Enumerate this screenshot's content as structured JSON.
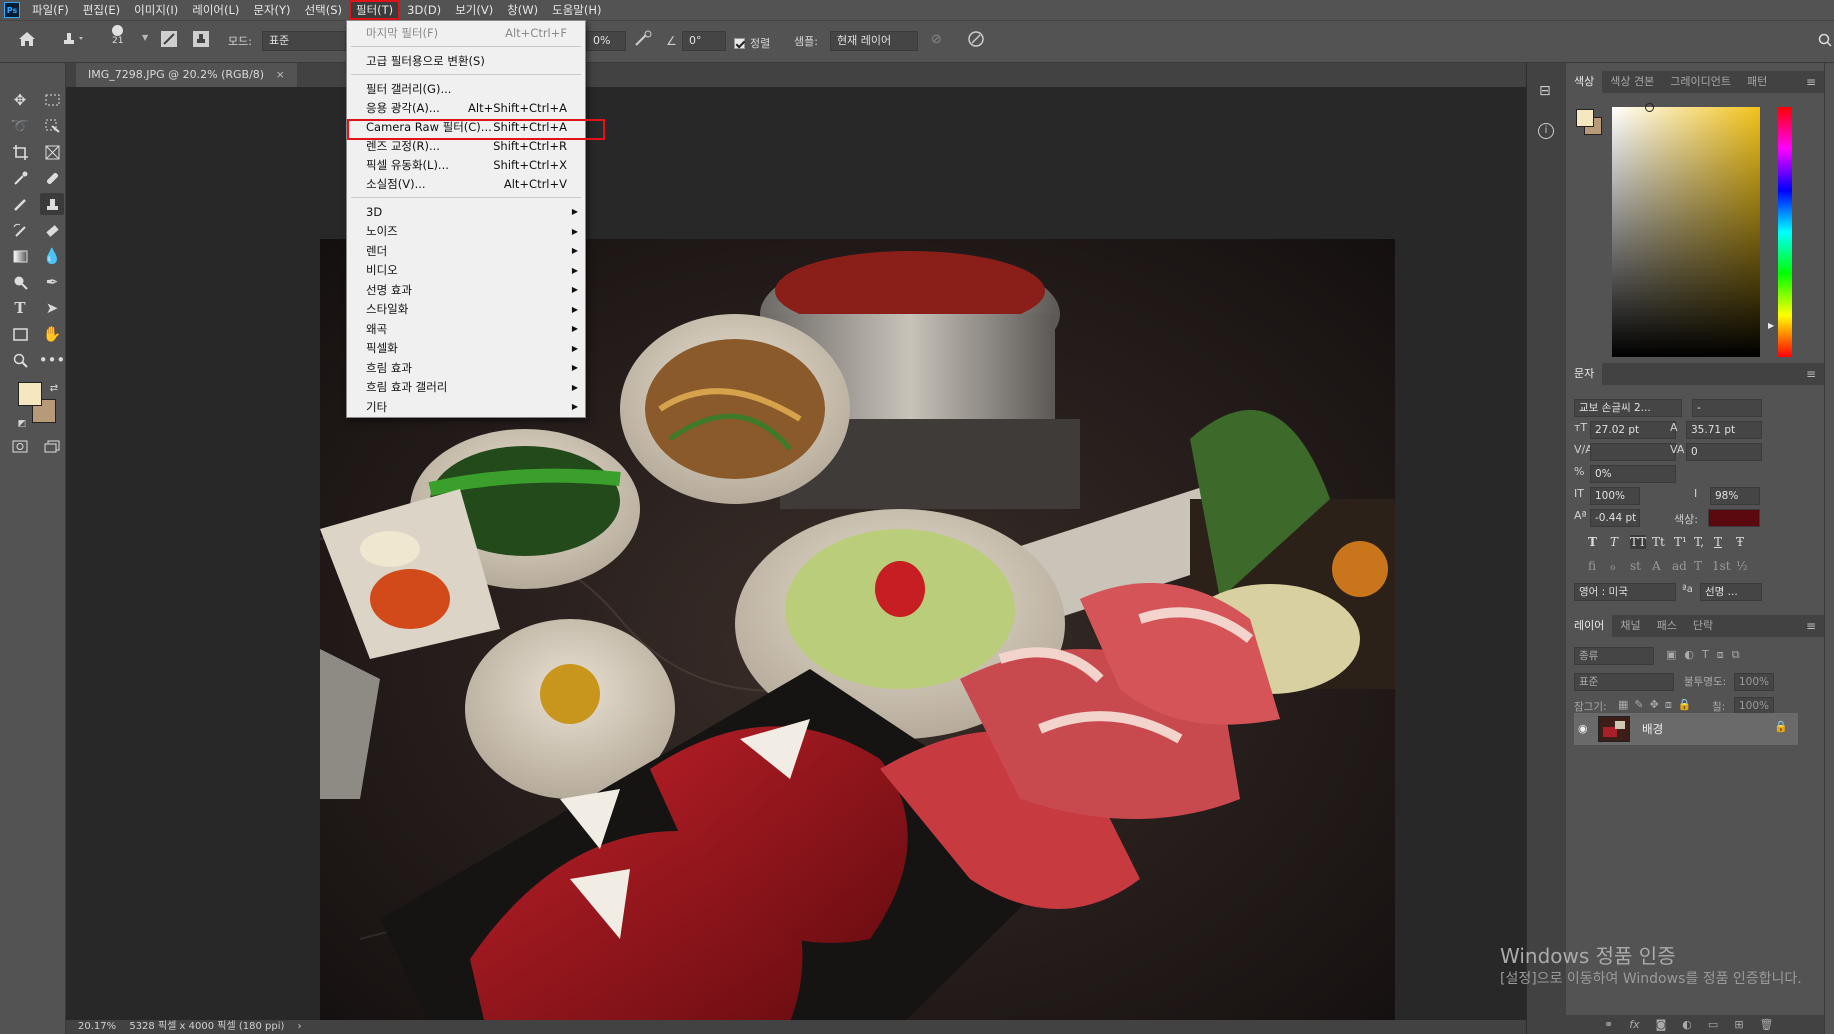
{
  "menubar": {
    "logo": "Ps",
    "items": [
      "파일(F)",
      "편집(E)",
      "이미지(I)",
      "레이어(L)",
      "문자(Y)",
      "선택(S)",
      "필터(T)",
      "3D(D)",
      "보기(V)",
      "창(W)",
      "도움말(H)"
    ],
    "active_index": 6
  },
  "options": {
    "brush_size": "21",
    "mode_label": "모드:",
    "mode_value": "표준",
    "opacity_value": "0%",
    "angle_value": "0°",
    "align_label": "정렬",
    "sample_label": "샘플:",
    "sample_value": "현재 레이어"
  },
  "document": {
    "tab_title": "IMG_7298.JPG @ 20.2% (RGB/8)",
    "tab_close": "×",
    "status_zoom": "20.17%",
    "status_size": "5328 픽셀 x 4000 픽셀 (180 ppi)",
    "status_arrow": "›"
  },
  "filter_menu": {
    "items": [
      {
        "label": "마지막 필터(F)",
        "shortcut": "Alt+Ctrl+F",
        "disabled": true
      },
      {
        "sep": true
      },
      {
        "label": "고급 필터용으로 변환(S)",
        "shortcut": ""
      },
      {
        "sep": true
      },
      {
        "label": "필터 갤러리(G)...",
        "shortcut": ""
      },
      {
        "label": "응용 광각(A)...",
        "shortcut": "Alt+Shift+Ctrl+A"
      },
      {
        "label": "Camera Raw 필터(C)...",
        "shortcut": "Shift+Ctrl+A"
      },
      {
        "label": "렌즈 교정(R)...",
        "shortcut": "Shift+Ctrl+R"
      },
      {
        "label": "픽셀 유동화(L)...",
        "shortcut": "Shift+Ctrl+X"
      },
      {
        "label": "소실점(V)...",
        "shortcut": "Alt+Ctrl+V"
      },
      {
        "sep": true
      },
      {
        "label": "3D",
        "submenu": true
      },
      {
        "label": "노이즈",
        "submenu": true
      },
      {
        "label": "렌더",
        "submenu": true
      },
      {
        "label": "비디오",
        "submenu": true
      },
      {
        "label": "선명 효과",
        "submenu": true
      },
      {
        "label": "스타일화",
        "submenu": true
      },
      {
        "label": "왜곡",
        "submenu": true
      },
      {
        "label": "픽셀화",
        "submenu": true
      },
      {
        "label": "흐림 효과",
        "submenu": true
      },
      {
        "label": "흐림 효과 갤러리",
        "submenu": true
      },
      {
        "label": "기타",
        "submenu": true
      }
    ]
  },
  "color_panel": {
    "tabs": [
      "색상",
      "색상 견본",
      "그레이디언트",
      "패턴"
    ],
    "foreground": "#f5e7c0",
    "background": "#b79b78"
  },
  "character_panel": {
    "title": "문자",
    "font_family": "교보 손글씨 2...",
    "font_style": "-",
    "font_size": "27.02 pt",
    "leading": "35.71 pt",
    "kerning": "",
    "tracking": "0",
    "scale_tsume": "0%",
    "vertical_scale": "100%",
    "horizontal_scale": "98%",
    "baseline_shift": "-0.44 pt",
    "color_label": "색상:",
    "text_color": "#5a0a0e",
    "language": "영어 : 미국",
    "aa_label": "ªa",
    "antialias": "선명 ...",
    "style_glyphs": [
      "T",
      "T",
      "TT",
      "Tt",
      "T¹",
      "T,",
      "T",
      "Ŧ"
    ],
    "opentype_glyphs": [
      "fi",
      "ℴ",
      "st",
      "A",
      "ad",
      "T",
      "1st",
      "½"
    ]
  },
  "layers_panel": {
    "tabs": [
      "레이어",
      "채널",
      "패스",
      "단락"
    ],
    "filter_label": "종류",
    "blend_mode": "표준",
    "opacity_label": "불투명도:",
    "opacity_value": "100%",
    "lock_label": "잠그기:",
    "fill_label": "칠:",
    "fill_value": "100%",
    "layer_name": "배경"
  },
  "watermark": {
    "line1": "Windows 정품 인증",
    "line2": "[설정]으로 이동하여 Windows를 정품 인증합니다."
  }
}
